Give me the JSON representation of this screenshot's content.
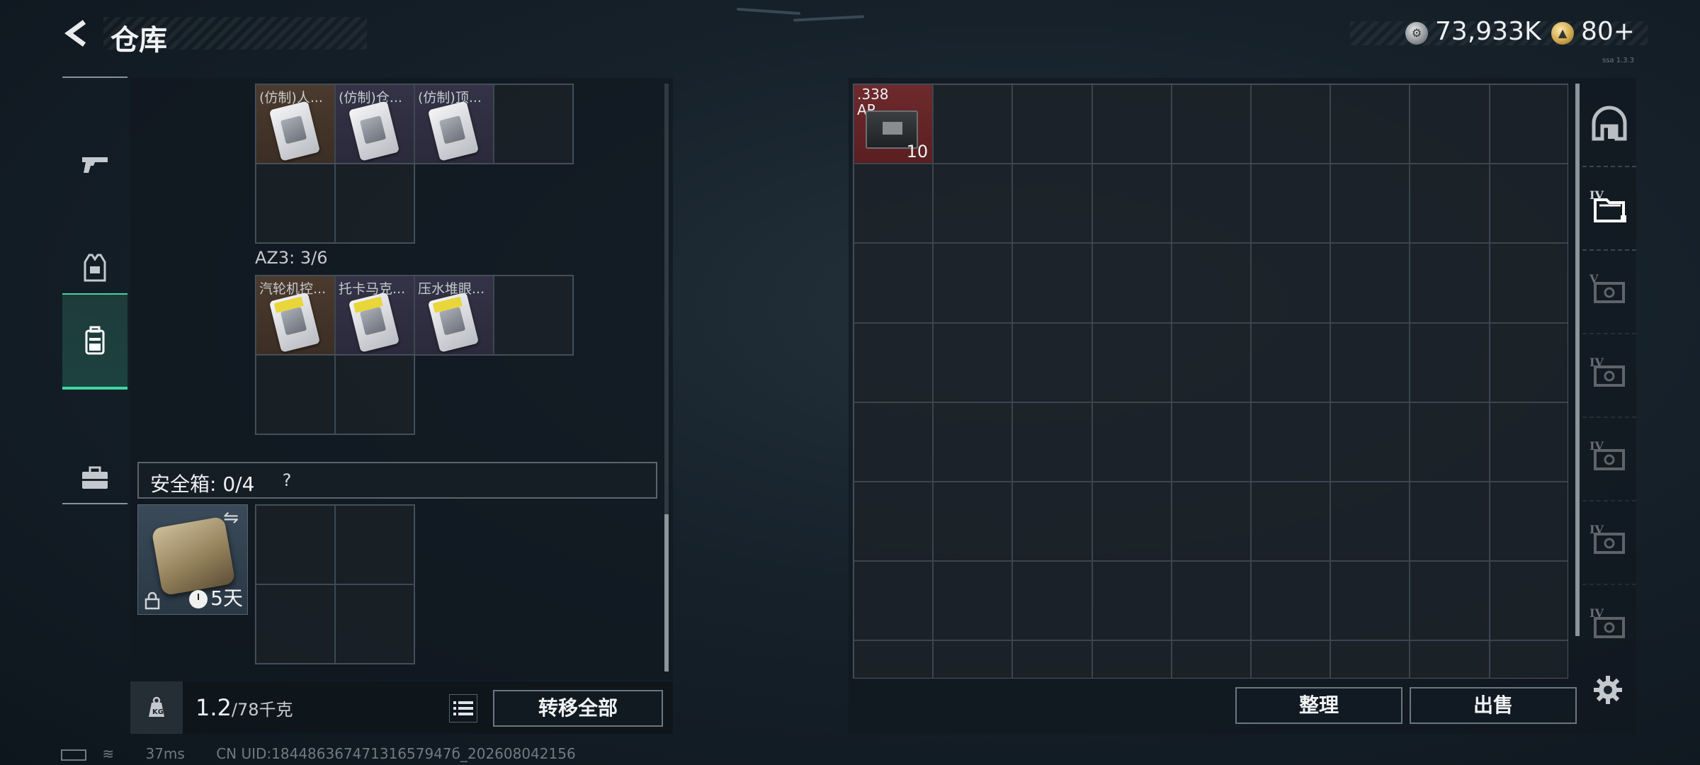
{
  "header": {
    "title": "仓库",
    "silver_amount": "73,933K",
    "gold_amount": "80+",
    "tiny_text": "ssa 1.3.3"
  },
  "categories": [
    {
      "icon": "pistol-icon"
    },
    {
      "icon": "vest-icon"
    },
    {
      "icon": "backpack-icon",
      "active": true
    },
    {
      "icon": "toolbox-icon"
    }
  ],
  "key_section_1": {
    "items": [
      {
        "name": "(仿制)人...",
        "rarity": "brown"
      },
      {
        "name": "(仿制)仓...",
        "rarity": "purple"
      },
      {
        "name": "(仿制)顶...",
        "rarity": "purple"
      }
    ]
  },
  "key_section_2": {
    "label": "AZ3: 3/6",
    "items": [
      {
        "name": "汽轮机控...",
        "rarity": "brown"
      },
      {
        "name": "托卡马克...",
        "rarity": "purple"
      },
      {
        "name": "压水堆眼...",
        "rarity": "purple"
      }
    ]
  },
  "safebox": {
    "label": "安全箱: 0/4",
    "help": "?",
    "days": "5天"
  },
  "footer_left": {
    "weight_current": "1.2",
    "weight_max": "/78千克",
    "transfer_all": "转移全部"
  },
  "storage": {
    "ammo": {
      "label_1": ".338",
      "label_2": "AP",
      "count": "10"
    }
  },
  "side_tabs": [
    {
      "label": "",
      "icon": "arch-icon"
    },
    {
      "label": "IV",
      "icon": "folder-icon"
    },
    {
      "label": "V",
      "icon": "container-icon"
    },
    {
      "label": "IV",
      "icon": "container-icon"
    },
    {
      "label": "IV",
      "icon": "container-icon"
    },
    {
      "label": "IV",
      "icon": "container-icon"
    },
    {
      "label": "IV",
      "icon": "container-icon"
    }
  ],
  "footer_right": {
    "organize": "整理",
    "sell": "出售"
  },
  "status_bar": {
    "ping": "37ms",
    "uid": "CN UID:18448636747131657947б_202608042156"
  },
  "colors": {
    "accent": "#3fd6a0",
    "rarity_brown": "#4b3a2e",
    "rarity_purple": "#343347",
    "ammo_red": "#6e2a2d"
  }
}
